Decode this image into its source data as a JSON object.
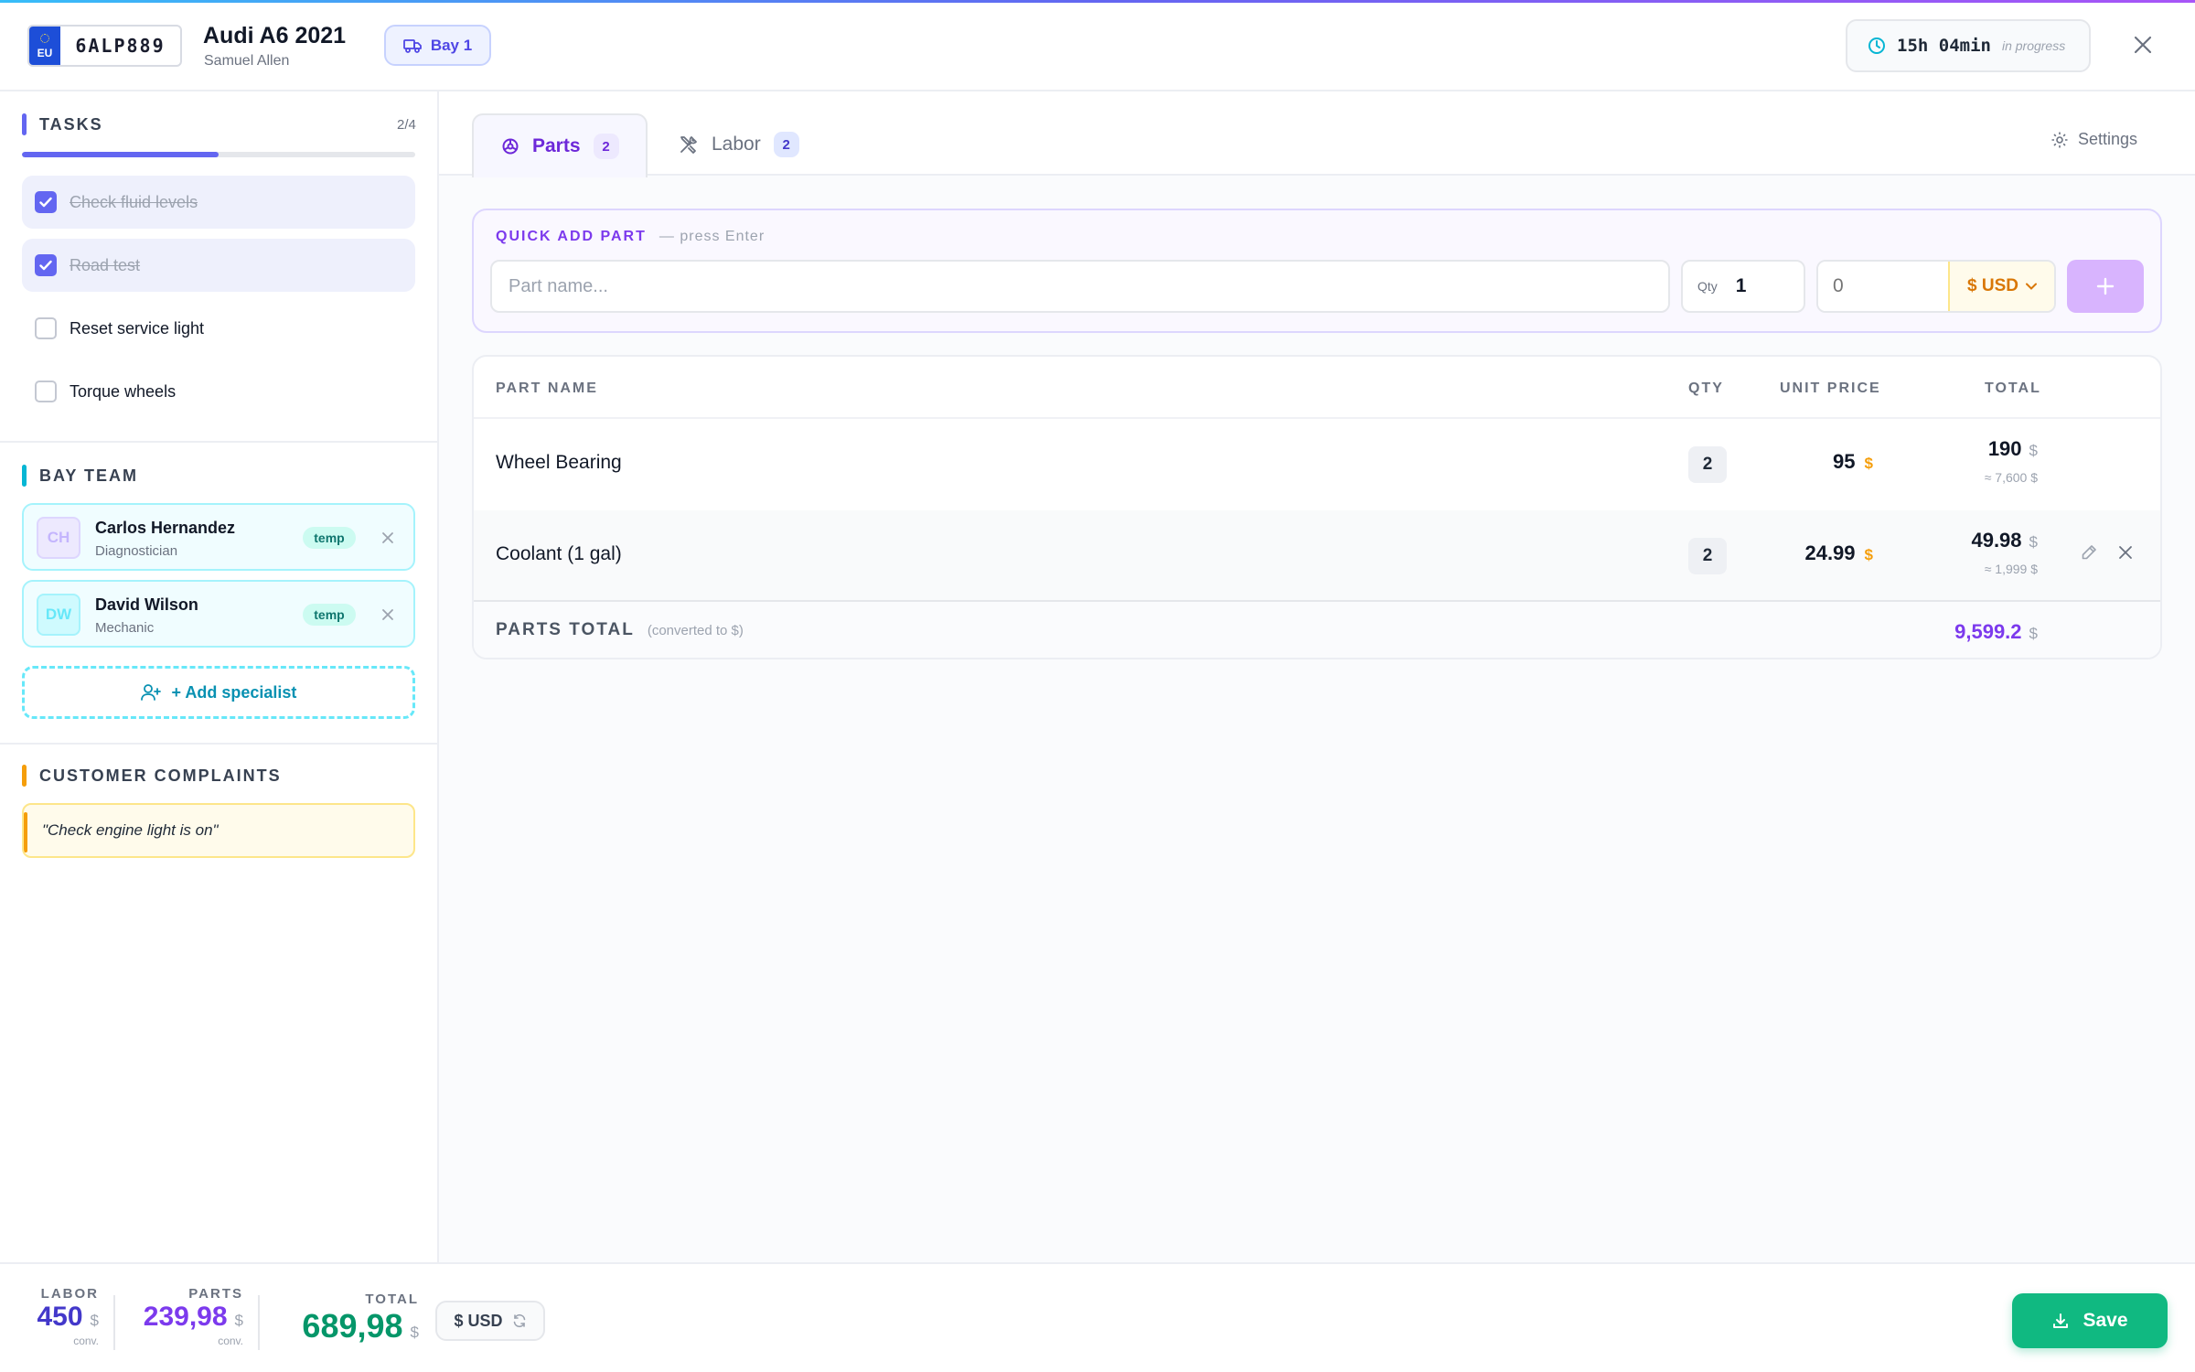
{
  "header": {
    "plate_region": "EU",
    "plate_number": "6ALP889",
    "car_title": "Audi A6 2021",
    "owner": "Samuel Allen",
    "bay_label": "Bay 1",
    "timer_value": "15h 04min",
    "timer_status": "in progress"
  },
  "sidebar": {
    "tasks_title": "TASKS",
    "tasks_count": "2/4",
    "tasks_progress": 0.5,
    "tasks": [
      {
        "label": "Check fluid levels",
        "done": true
      },
      {
        "label": "Road test",
        "done": true
      },
      {
        "label": "Reset service light",
        "done": false
      },
      {
        "label": "Torque wheels",
        "done": false
      }
    ],
    "team_title": "BAY TEAM",
    "team": [
      {
        "initials": "CH",
        "name": "Carlos Hernandez",
        "role": "Diagnostician",
        "tag": "temp"
      },
      {
        "initials": "DW",
        "name": "David Wilson",
        "role": "Mechanic",
        "tag": "temp"
      }
    ],
    "add_specialist_label": "+ Add specialist",
    "complaints_title": "CUSTOMER COMPLAINTS",
    "complaint": "\"Check engine light is on\""
  },
  "tabs": {
    "parts_label": "Parts",
    "parts_count": "2",
    "labor_label": "Labor",
    "labor_count": "2",
    "settings_label": "Settings"
  },
  "quick_add": {
    "title": "QUICK ADD PART",
    "hint": "— press Enter",
    "part_placeholder": "Part name...",
    "qty_label": "Qty",
    "qty_value": "1",
    "price_placeholder": "0",
    "currency": "$ USD"
  },
  "parts_table": {
    "headers": {
      "name": "PART NAME",
      "qty": "QTY",
      "unit_price": "UNIT PRICE",
      "total": "TOTAL"
    },
    "rows": [
      {
        "name": "Wheel Bearing",
        "qty": "2",
        "unit_price": "95",
        "price_currency": "$",
        "total": "190",
        "total_currency": "$",
        "converted": "≈ 7,600 $"
      },
      {
        "name": "Coolant (1 gal)",
        "qty": "2",
        "unit_price": "24.99",
        "price_currency": "$",
        "total": "49.98",
        "total_currency": "$",
        "converted": "≈ 1,999 $"
      }
    ],
    "footer_label": "PARTS TOTAL",
    "footer_sub": "(converted to $)",
    "footer_total": "9,599.2",
    "footer_currency": "$"
  },
  "bottom": {
    "labor_label": "LABOR",
    "labor_value": "450",
    "labor_currency": "$",
    "labor_conv": "conv.",
    "parts_label": "PARTS",
    "parts_value": "239,98",
    "parts_currency": "$",
    "parts_conv": "conv.",
    "total_label": "TOTAL",
    "total_value": "689,98",
    "total_currency": "$",
    "currency_toggle": "$ USD",
    "save_label": "Save"
  },
  "colors": {
    "accent": "#6366f1",
    "parts_purple": "#7c3aed",
    "team_cyan": "#06b6d4",
    "complaint_amber": "#f59e0b",
    "save_green": "#10b981",
    "labor_blue": "#4338ca",
    "total_green": "#059669"
  }
}
